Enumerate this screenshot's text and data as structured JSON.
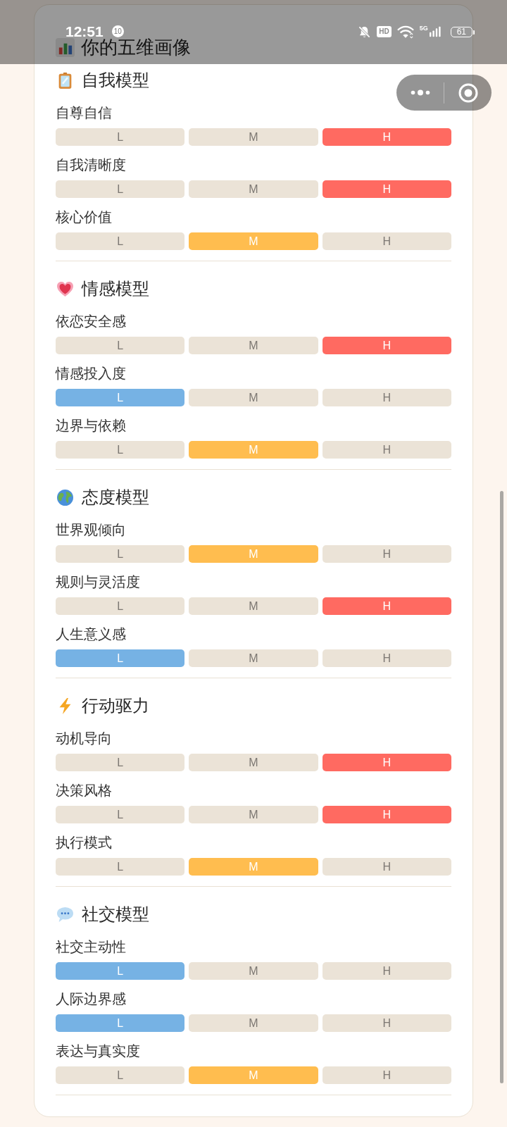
{
  "status_bar": {
    "time": "12:51",
    "notification_count": "10",
    "hd": "HD",
    "network": "5G",
    "battery": "61"
  },
  "header": {
    "title": "你的五维画像"
  },
  "sections": [
    {
      "title": "自我模型",
      "traits": [
        {
          "name": "自尊自信",
          "options": [
            {
              "label": "L",
              "selected": false
            },
            {
              "label": "M",
              "selected": false
            },
            {
              "label": "H",
              "selected": true
            }
          ]
        },
        {
          "name": "自我清晰度",
          "options": [
            {
              "label": "L",
              "selected": false
            },
            {
              "label": "M",
              "selected": false
            },
            {
              "label": "H",
              "selected": true
            }
          ]
        },
        {
          "name": "核心价值",
          "options": [
            {
              "label": "L",
              "selected": false
            },
            {
              "label": "M",
              "selected": true
            },
            {
              "label": "H",
              "selected": false
            }
          ]
        }
      ]
    },
    {
      "title": "情感模型",
      "traits": [
        {
          "name": "依恋安全感",
          "options": [
            {
              "label": "L",
              "selected": false
            },
            {
              "label": "M",
              "selected": false
            },
            {
              "label": "H",
              "selected": true
            }
          ]
        },
        {
          "name": "情感投入度",
          "options": [
            {
              "label": "L",
              "selected": true
            },
            {
              "label": "M",
              "selected": false
            },
            {
              "label": "H",
              "selected": false
            }
          ]
        },
        {
          "name": "边界与依赖",
          "options": [
            {
              "label": "L",
              "selected": false
            },
            {
              "label": "M",
              "selected": true
            },
            {
              "label": "H",
              "selected": false
            }
          ]
        }
      ]
    },
    {
      "title": "态度模型",
      "traits": [
        {
          "name": "世界观倾向",
          "options": [
            {
              "label": "L",
              "selected": false
            },
            {
              "label": "M",
              "selected": true
            },
            {
              "label": "H",
              "selected": false
            }
          ]
        },
        {
          "name": "规则与灵活度",
          "options": [
            {
              "label": "L",
              "selected": false
            },
            {
              "label": "M",
              "selected": false
            },
            {
              "label": "H",
              "selected": true
            }
          ]
        },
        {
          "name": "人生意义感",
          "options": [
            {
              "label": "L",
              "selected": true
            },
            {
              "label": "M",
              "selected": false
            },
            {
              "label": "H",
              "selected": false
            }
          ]
        }
      ]
    },
    {
      "title": "行动驱力",
      "traits": [
        {
          "name": "动机导向",
          "options": [
            {
              "label": "L",
              "selected": false
            },
            {
              "label": "M",
              "selected": false
            },
            {
              "label": "H",
              "selected": true
            }
          ]
        },
        {
          "name": "决策风格",
          "options": [
            {
              "label": "L",
              "selected": false
            },
            {
              "label": "M",
              "selected": false
            },
            {
              "label": "H",
              "selected": true
            }
          ]
        },
        {
          "name": "执行模式",
          "options": [
            {
              "label": "L",
              "selected": false
            },
            {
              "label": "M",
              "selected": true
            },
            {
              "label": "H",
              "selected": false
            }
          ]
        }
      ]
    },
    {
      "title": "社交模型",
      "traits": [
        {
          "name": "社交主动性",
          "options": [
            {
              "label": "L",
              "selected": true
            },
            {
              "label": "M",
              "selected": false
            },
            {
              "label": "H",
              "selected": false
            }
          ]
        },
        {
          "name": "人际边界感",
          "options": [
            {
              "label": "L",
              "selected": true
            },
            {
              "label": "M",
              "selected": false
            },
            {
              "label": "H",
              "selected": false
            }
          ]
        },
        {
          "name": "表达与真实度",
          "options": [
            {
              "label": "L",
              "selected": false
            },
            {
              "label": "M",
              "selected": true
            },
            {
              "label": "H",
              "selected": false
            }
          ]
        }
      ]
    }
  ]
}
